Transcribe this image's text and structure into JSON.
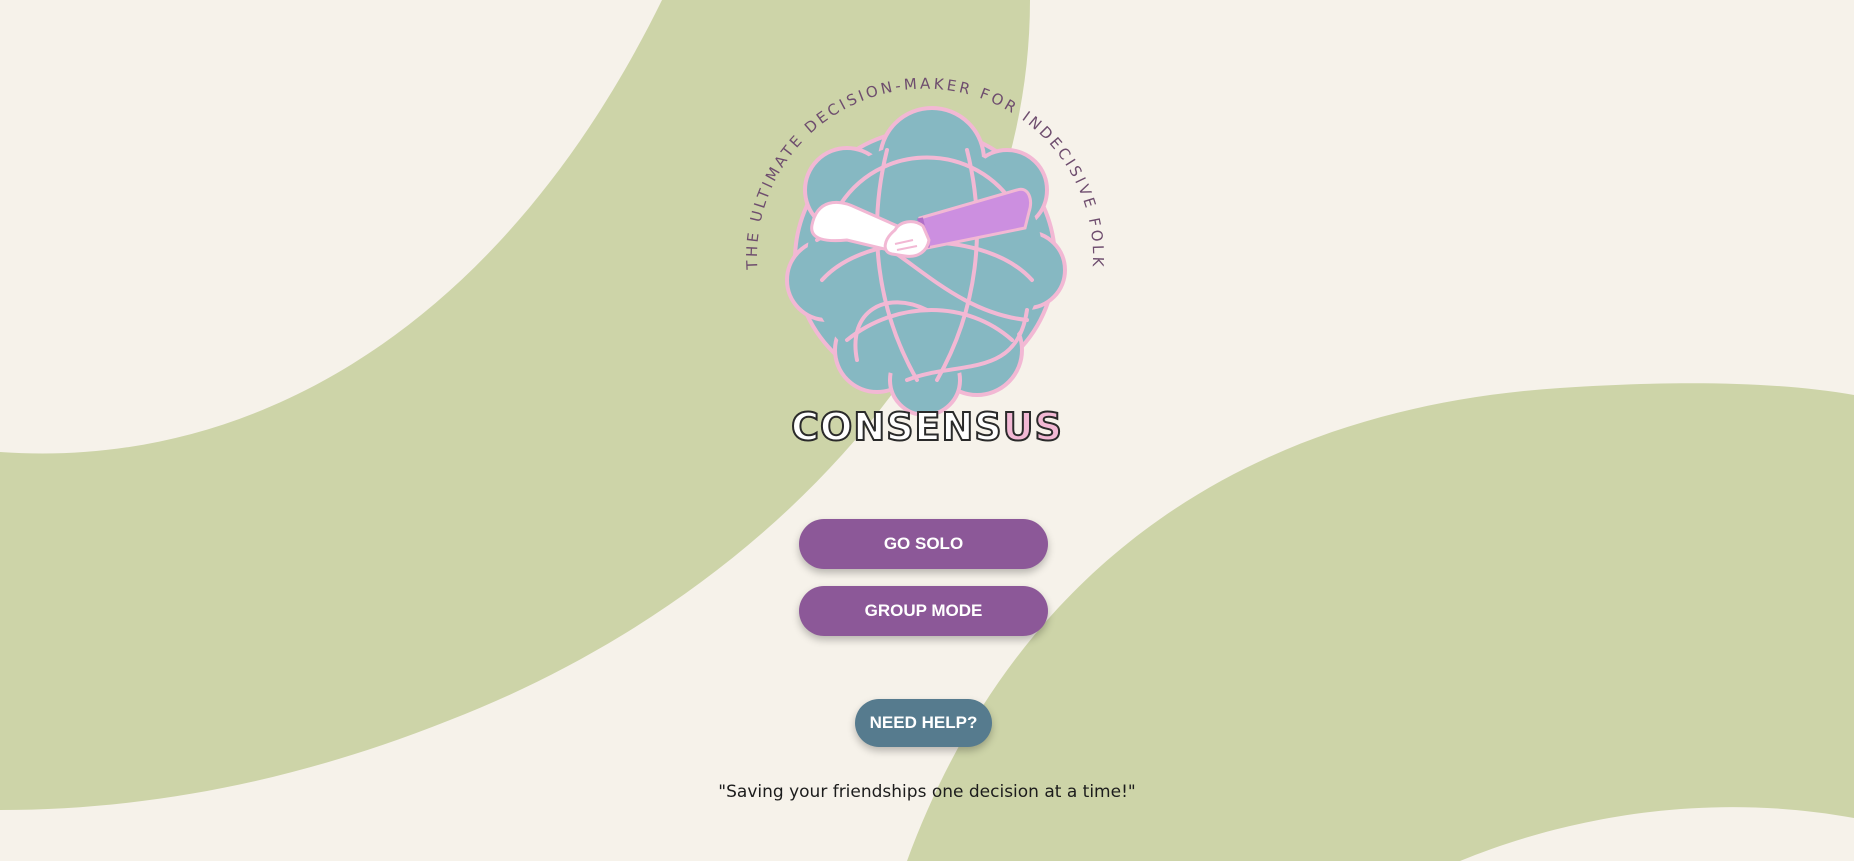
{
  "colors": {
    "background": "#f6f2ea",
    "green_band": "#cdd4a8",
    "primary_button": "#8c5898",
    "help_button": "#567b8e",
    "knot_fill": "#86b8c2",
    "knot_outline": "#f2b8d4",
    "arc_text": "#6e4d6e"
  },
  "logo": {
    "arc_text": "THE ULTIMATE DECISION-MAKER FOR INDECISIVE FOLK",
    "wordmark_main": "CONSENS",
    "wordmark_accent": "US",
    "icon": "tangled-knot-handshake-logo"
  },
  "buttons": {
    "solo_label": "GO SOLO",
    "group_label": "GROUP MODE",
    "help_label": "NEED HELP?"
  },
  "tagline": "\"Saving your friendships one decision at a time!\""
}
